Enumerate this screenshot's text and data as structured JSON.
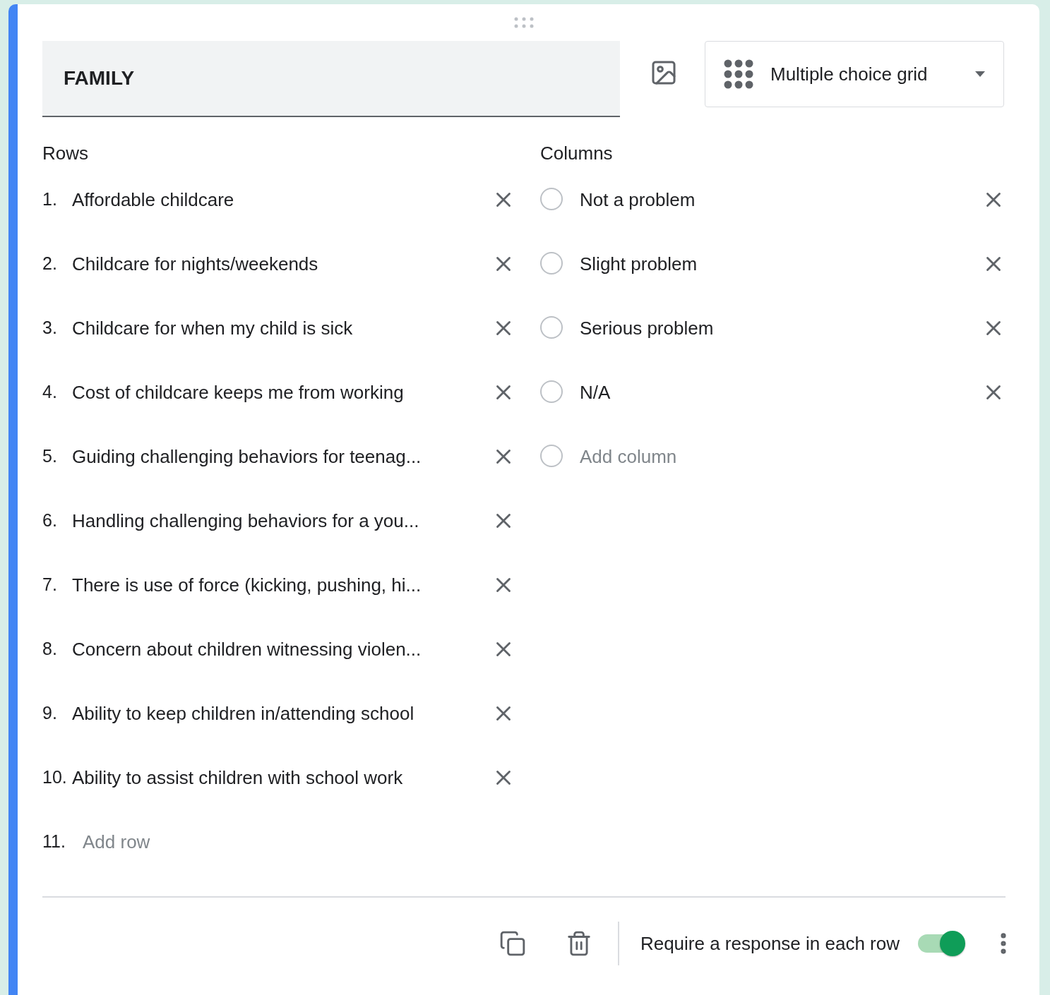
{
  "question": {
    "title": "FAMILY",
    "type": "Multiple choice grid"
  },
  "rows_label": "Rows",
  "rows": [
    {
      "number": "1.",
      "text": "Affordable childcare"
    },
    {
      "number": "2.",
      "text": "Childcare for nights/weekends"
    },
    {
      "number": "3.",
      "text": "Childcare for when my child is sick"
    },
    {
      "number": "4.",
      "text": "Cost of childcare keeps me from working"
    },
    {
      "number": "5.",
      "text": "Guiding challenging behaviors for teenag..."
    },
    {
      "number": "6.",
      "text": "Handling challenging behaviors for a you..."
    },
    {
      "number": "7.",
      "text": "There is use of force (kicking, pushing, hi..."
    },
    {
      "number": "8.",
      "text": "Concern about children witnessing violen..."
    },
    {
      "number": "9.",
      "text": "Ability to keep children in/attending school"
    },
    {
      "number": "10.",
      "text": "Ability to assist children with school work"
    }
  ],
  "add_row": {
    "number": "11.",
    "placeholder": "Add row"
  },
  "columns_label": "Columns",
  "columns": [
    {
      "text": "Not a problem"
    },
    {
      "text": "Slight problem"
    },
    {
      "text": "Serious problem"
    },
    {
      "text": "N/A"
    }
  ],
  "add_column": {
    "placeholder": "Add column"
  },
  "footer": {
    "required_label": "Require a response in each row",
    "required": true
  }
}
